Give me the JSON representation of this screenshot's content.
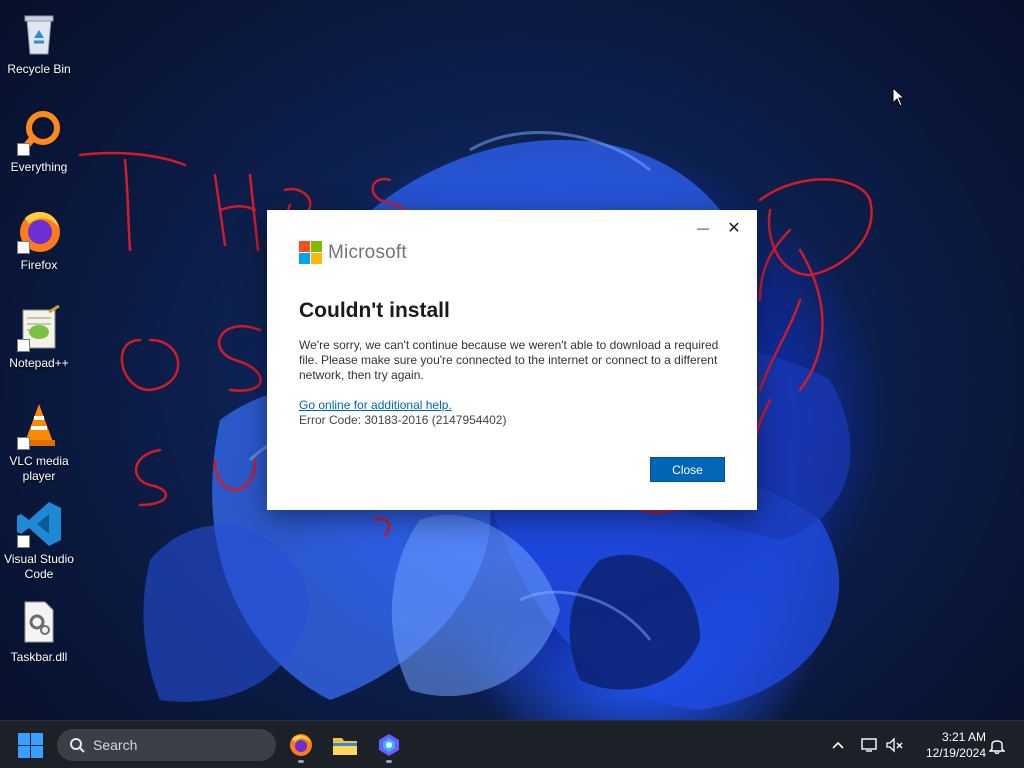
{
  "desktop": {
    "icons": [
      {
        "label": "Recycle Bin",
        "icon": "recycle-bin-icon"
      },
      {
        "label": "Everything",
        "icon": "everything-search-icon"
      },
      {
        "label": "Firefox",
        "icon": "firefox-icon"
      },
      {
        "label": "Notepad++",
        "icon": "notepad-plus-plus-icon"
      },
      {
        "label": "VLC media player",
        "icon": "vlc-icon"
      },
      {
        "label": "Visual Studio Code",
        "icon": "vscode-icon"
      },
      {
        "label": "Taskbar.dll",
        "icon": "dll-file-icon"
      }
    ]
  },
  "dialog": {
    "brand": "Microsoft",
    "title": "Couldn't install",
    "body": "We're sorry, we can't continue because we weren't able to download a required file.  Please make sure you're connected to the internet or connect to a different network, then try again.",
    "help_link": "Go online for additional help.",
    "error_code": "Error Code: 30183-2016 (2147954402)",
    "close_label": "Close",
    "minimize_glyph": "—",
    "close_glyph": "✕"
  },
  "taskbar": {
    "search_label": "Search",
    "apps": [
      "firefox-icon",
      "file-explorer-icon",
      "copilot-icon"
    ],
    "clock": {
      "time": "3:21 AM",
      "date": "12/19/2024"
    }
  },
  "colors": {
    "accent": "#0067b8",
    "scribble": "#d11b2a",
    "taskbar": "#1c2027"
  }
}
